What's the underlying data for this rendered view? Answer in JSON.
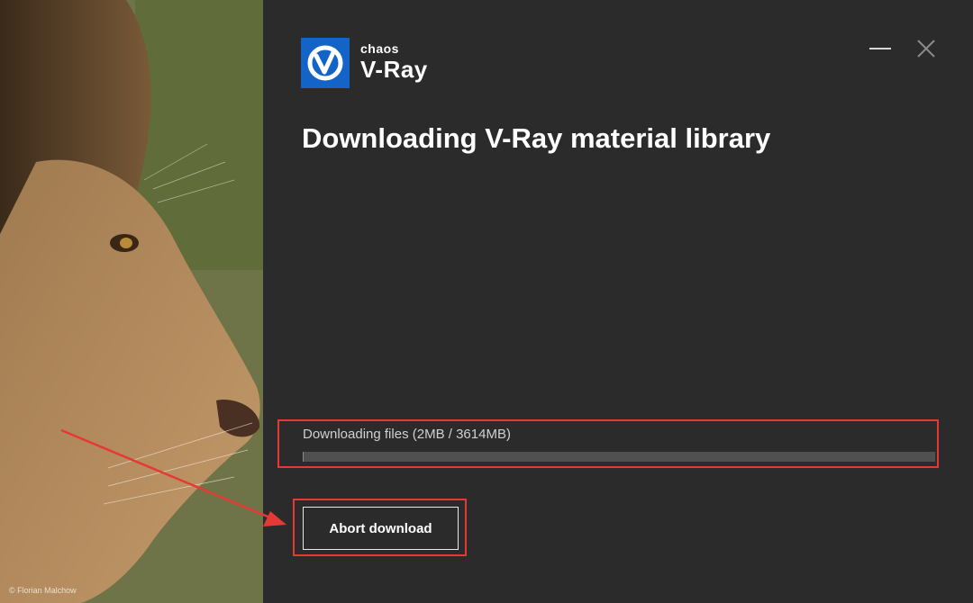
{
  "photo": {
    "credit": "© Florian Malchow"
  },
  "brand": {
    "company": "chaos",
    "product": "V-Ray",
    "accent_color": "#1464c8"
  },
  "window": {
    "minimize_icon": "minimize-icon",
    "close_icon": "close-icon"
  },
  "dialog": {
    "title": "Downloading V-Ray material library"
  },
  "progress": {
    "label": "Downloading files (2MB / 3614MB)",
    "downloaded_mb": 2,
    "total_mb": 3614,
    "fraction": 0.0006
  },
  "actions": {
    "abort_label": "Abort download"
  },
  "annotations": {
    "highlight_color": "#e53935"
  }
}
